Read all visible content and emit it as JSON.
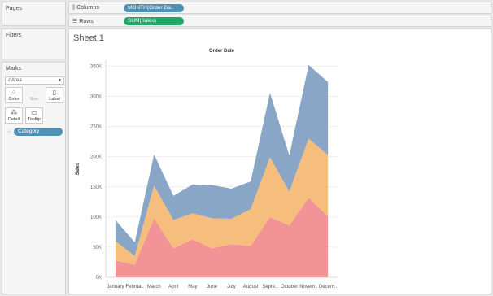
{
  "pages": {
    "title": "Pages"
  },
  "filters": {
    "title": "Filters"
  },
  "marks": {
    "title": "Marks",
    "mark_type": "Area",
    "buttons": [
      {
        "label": "Color",
        "icon": "color-icon",
        "enabled": true
      },
      {
        "label": "Size",
        "icon": "size-icon",
        "enabled": false
      },
      {
        "label": "Label",
        "icon": "label-icon",
        "enabled": true
      },
      {
        "label": "Detail",
        "icon": "detail-icon",
        "enabled": true
      },
      {
        "label": "Tooltip",
        "icon": "tooltip-icon",
        "enabled": true
      }
    ],
    "color_field": "Category"
  },
  "shelves": {
    "columns_label": "Columns",
    "columns_pill": "MONTH(Order Da..",
    "rows_label": "Rows",
    "rows_pill": "SUM(Sales)"
  },
  "sheet": {
    "title": "Sheet 1"
  },
  "colors": {
    "series_bottom": "#f29496",
    "series_middle": "#f6be7d",
    "series_top": "#8aa6c6",
    "pill_dimension": "#4d91b4",
    "pill_measure": "#1fa868"
  },
  "chart_data": {
    "type": "area",
    "stacked": true,
    "title": "Order Date",
    "xlabel": "",
    "ylabel": "Sales",
    "categories": [
      "January",
      "Februa..",
      "March",
      "April",
      "May",
      "June",
      "July",
      "August",
      "Septe..",
      "October",
      "Novem..",
      "Decem.."
    ],
    "y_ticks": [
      "0K",
      "50K",
      "100K",
      "150K",
      "200K",
      "250K",
      "300K",
      "350K"
    ],
    "ylim": [
      0,
      360000
    ],
    "grid": true,
    "series": [
      {
        "values": [
          28000,
          21000,
          98000,
          48000,
          63000,
          48000,
          55000,
          52000,
          100000,
          86000,
          132000,
          101000
        ]
      },
      {
        "values": [
          32000,
          14000,
          54000,
          47000,
          43000,
          50000,
          42000,
          61000,
          99000,
          56000,
          98000,
          102000
        ]
      },
      {
        "values": [
          35000,
          23000,
          52000,
          40000,
          48000,
          55000,
          50000,
          46000,
          107000,
          60000,
          122000,
          121000
        ]
      }
    ]
  }
}
